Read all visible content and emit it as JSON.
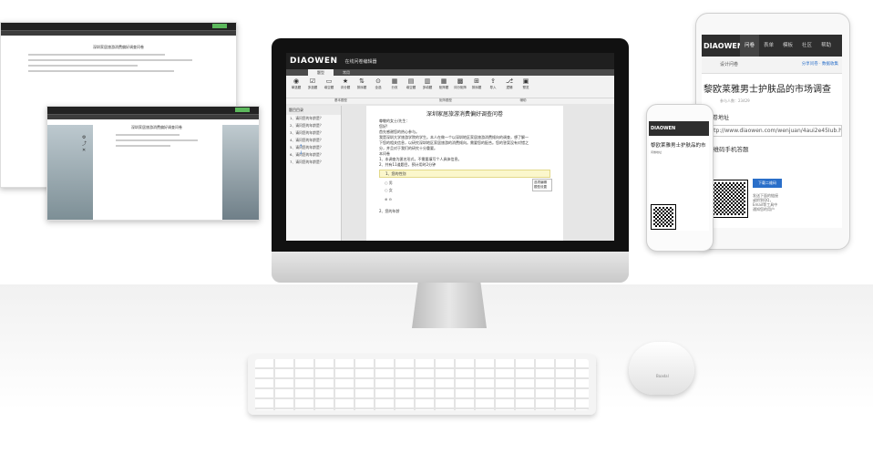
{
  "left_shots": {
    "shot1_title": "深圳家居旅游消费偏好调查问卷",
    "shot2_title": "深圳家居旅游消费偏好调查问卷"
  },
  "app": {
    "logo": "DIAOWEN",
    "title": "在线问卷编辑器",
    "tabs": [
      "题型",
      "常用"
    ],
    "ribbon": [
      {
        "icon": "radio-icon",
        "glyph": "◉",
        "label": "单选题"
      },
      {
        "icon": "checkbox-icon",
        "glyph": "☑",
        "label": "多选题"
      },
      {
        "icon": "fill-icon",
        "glyph": "▭",
        "label": "填空题"
      },
      {
        "icon": "star-icon",
        "glyph": "★",
        "label": "评分题"
      },
      {
        "icon": "sort-icon",
        "glyph": "⇅",
        "label": "排序题"
      },
      {
        "icon": "select-all-icon",
        "glyph": "⊙",
        "label": "全选"
      },
      {
        "icon": "pagebreak-icon",
        "glyph": "▦",
        "label": "分页"
      },
      {
        "icon": "fill-blank-icon",
        "glyph": "▤",
        "label": "填空题"
      },
      {
        "icon": "multi-fill-icon",
        "glyph": "▥",
        "label": "多填题"
      },
      {
        "icon": "matrix-icon",
        "glyph": "▦",
        "label": "矩阵题"
      },
      {
        "icon": "rating-icon",
        "glyph": "▩",
        "label": "评分矩阵"
      },
      {
        "icon": "sort2-icon",
        "glyph": "⊞",
        "label": "排序题"
      },
      {
        "icon": "import-icon",
        "glyph": "⇪",
        "label": "导入"
      },
      {
        "icon": "logic-icon",
        "glyph": "⎇",
        "label": "逻辑"
      },
      {
        "icon": "preview-icon",
        "glyph": "▣",
        "label": "预览"
      }
    ],
    "groups": [
      "基本题型",
      "矩阵题型",
      "辅助"
    ],
    "outline_header": "题目目录",
    "outline_items": [
      "1、请问您的年龄是？",
      "2、请问您的年龄是？",
      "3、请问您的年龄是？",
      "4、请问您的年龄是？",
      "5、请问您的年龄是？",
      "6、请问您的年龄是？",
      "7、请问您的年龄是？"
    ],
    "doc_title": "深圳家居旅游消费偏好调查问卷",
    "doc_lines": [
      "尊敬的女士/先生：",
      "您好!",
      "首先感谢您的热心参与。",
      "我是深圳大学旅游学院的学生。本人在做一个以深圳地区家居旅游消费倾向的调查，想了解一",
      "下您的相关信息，以研究深圳地区家居旅游的消费倾向。需要您的配合。您的答案没有对错之",
      "分，并且对于我们的研究十分重要。",
      "本问卷",
      "1、本调查为匿名形式，不需要填写个人具体信息。",
      "2、共有11道题目，预计用时2分钟"
    ],
    "q1_label": "1、",
    "q1_text": "您的性别",
    "q1_options": [
      "男",
      "女"
    ],
    "q2_text": "2、您的年龄",
    "side_menu": [
      "选项编辑",
      "题型设置"
    ]
  },
  "ipad": {
    "brand": "DIAOWEN",
    "nav": [
      "问卷",
      "表单",
      "模板",
      "社区",
      "帮助"
    ],
    "sub_left": "设计问卷",
    "sub_right1": "分享问卷",
    "sub_right2": "数据收集",
    "title": "黎欧莱雅男士护肤品的市场调查",
    "meta": "参与人数：23429",
    "link_heading": "问卷地址",
    "url": "http://www.diaowen.com/wenjuan/4aui2e45Iub.htm",
    "qr_heading": "二维码手机答题",
    "download_btn": "下载二维码",
    "notes": [
      "发送下面的链接",
      "或把到QQ，",
      "Email等工具中",
      "通知您的用户"
    ]
  },
  "iphone": {
    "brand": "DIAOWEN",
    "title": "黎欧莱雅男士护肤品的市",
    "text": "问卷地址"
  },
  "mouse_logo": "Baadal",
  "colors": {
    "accent": "#2a6fc9",
    "topbar": "#1f1f1f",
    "highlight": "#fbf7cc"
  }
}
